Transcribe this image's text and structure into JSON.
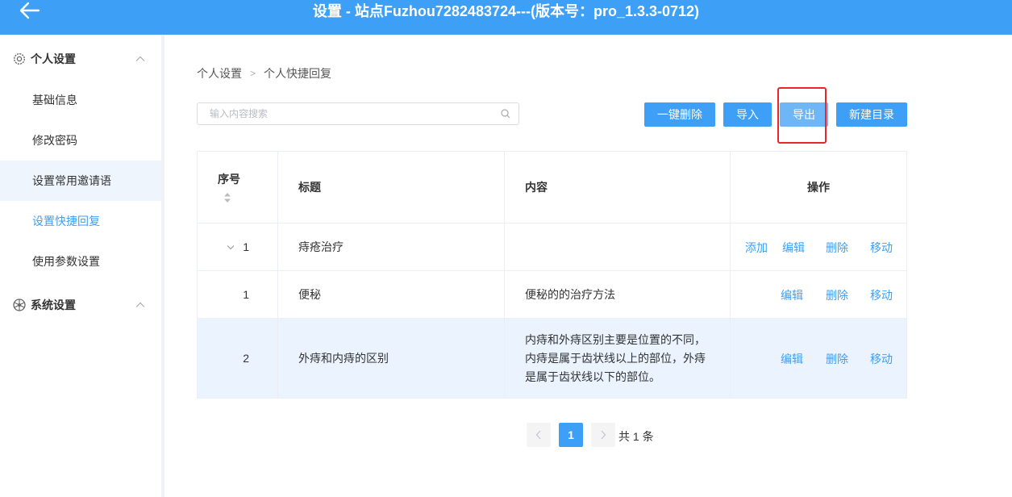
{
  "header": {
    "title": "设置 - 站点Fuzhou7282483724---(版本号：pro_1.3.3-0712)",
    "bg_color": "#3d9ff5"
  },
  "sidebar": {
    "groups": [
      {
        "label": "个人设置",
        "icon": "gear-icon",
        "items": [
          "基础信息",
          "修改密码",
          "设置常用邀请语",
          "设置快捷回复",
          "使用参数设置"
        ]
      },
      {
        "label": "系统设置",
        "icon": "aperture-icon",
        "items": []
      }
    ],
    "active_item": "设置快捷回复",
    "hovered_item": "设置常用邀请语"
  },
  "breadcrumb": [
    "个人设置",
    "个人快捷回复"
  ],
  "search": {
    "placeholder": "输入内容搜索"
  },
  "toolbar": {
    "delete_all": "一键删除",
    "import": "导入",
    "export": "导出",
    "new_dir": "新建目录"
  },
  "table": {
    "headers": [
      "序号",
      "标题",
      "内容",
      "操作"
    ],
    "rows": [
      {
        "index": "1",
        "title": "痔疮治疗",
        "content": "",
        "ops": [
          "添加",
          "编辑",
          "删除",
          "移动"
        ],
        "expandable": true
      },
      {
        "index": "1",
        "title": "便秘",
        "content": "便秘的的治疗方法",
        "ops": [
          "编辑",
          "删除",
          "移动"
        ]
      },
      {
        "index": "2",
        "title": "外痔和内痔的区别",
        "content_lines": [
          "内痔和外痔区别主要是位置的不同，",
          "内痔是属于齿状线以上的部位，外痔",
          "是属于齿状线以下的部位。"
        ],
        "ops": [
          "编辑",
          "删除",
          "移动"
        ]
      }
    ]
  },
  "pagination": {
    "current": "1",
    "total_text": "共 1 条"
  },
  "colors": {
    "accent": "#3d9ff5",
    "highlight_border": "#e8262b"
  }
}
